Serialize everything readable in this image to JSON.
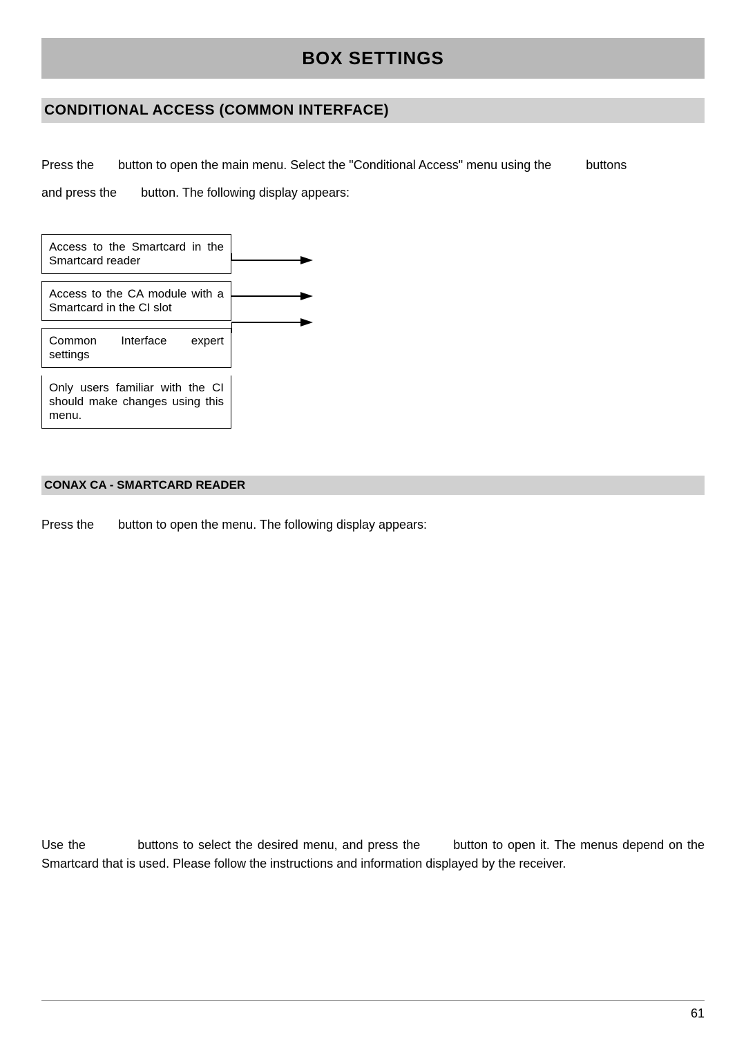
{
  "title": "BOX SETTINGS",
  "section_heading": "CONDITIONAL ACCESS (COMMON INTERFACE)",
  "intro_line1a": "Press the ",
  "intro_line1b": " button to open the main menu. Select the \"Conditional Access\" menu using the ",
  "intro_line1c": " buttons",
  "intro_line2a": "and press the ",
  "intro_line2b": " button. The following display appears:",
  "callouts": {
    "c1": "Access to the Smartcard in the Smartcard reader",
    "c2": "Access to the CA module with a Smartcard in the CI slot",
    "c3": "Common Interface expert settings",
    "c4": "Only users familiar with the CI should make changes using this menu."
  },
  "subsection_heading": "CONAX CA - SMARTCARD READER",
  "sub_line_a": "Press the ",
  "sub_line_b": " button to open the menu. The following display appears:",
  "lower_a": "Use the ",
  "lower_b": " buttons to select the desired menu, and press the ",
  "lower_c": " button to open it. The menus depend on the Smartcard that is used. Please follow the instructions and information displayed by the receiver.",
  "page_number": "61"
}
